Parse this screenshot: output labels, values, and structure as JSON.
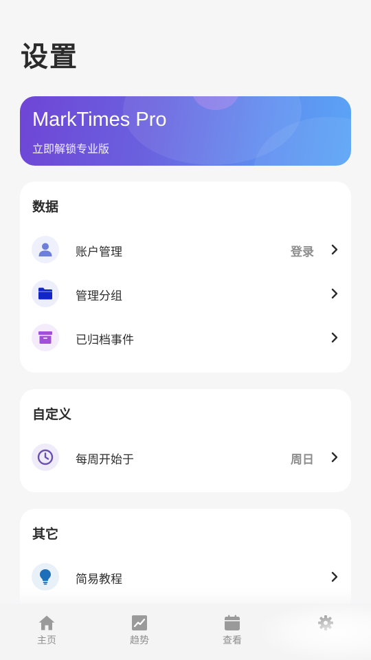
{
  "page": {
    "title": "设置"
  },
  "pro_banner": {
    "title": "MarkTimes Pro",
    "subtitle": "立即解锁专业版"
  },
  "sections": {
    "data": {
      "title": "数据",
      "items": [
        {
          "label": "账户管理",
          "value": "登录",
          "icon": "user-icon"
        },
        {
          "label": "管理分组",
          "value": "",
          "icon": "folder-icon"
        },
        {
          "label": "已归档事件",
          "value": "",
          "icon": "archive-icon"
        }
      ]
    },
    "custom": {
      "title": "自定义",
      "items": [
        {
          "label": "每周开始于",
          "value": "周日",
          "icon": "clock-icon"
        }
      ]
    },
    "other": {
      "title": "其它",
      "items": [
        {
          "label": "简易教程",
          "value": "",
          "icon": "lightbulb-icon"
        }
      ]
    }
  },
  "bottom_nav": {
    "items": [
      {
        "label": "主页",
        "icon": "home-icon"
      },
      {
        "label": "趋势",
        "icon": "trend-icon"
      },
      {
        "label": "查看",
        "icon": "calendar-icon"
      },
      {
        "label": "",
        "icon": "gear-icon",
        "active": true
      }
    ]
  },
  "colors": {
    "background": "#f6f6f7",
    "card": "#ffffff",
    "banner_start": "#6f45d6",
    "banner_end": "#5aa5f6",
    "user_icon": "#6d7fd8",
    "folder_icon": "#1226c8",
    "archive_icon": "#a24fd8",
    "clock_icon": "#6a4fb0",
    "lightbulb_icon": "#1f6fb8"
  }
}
